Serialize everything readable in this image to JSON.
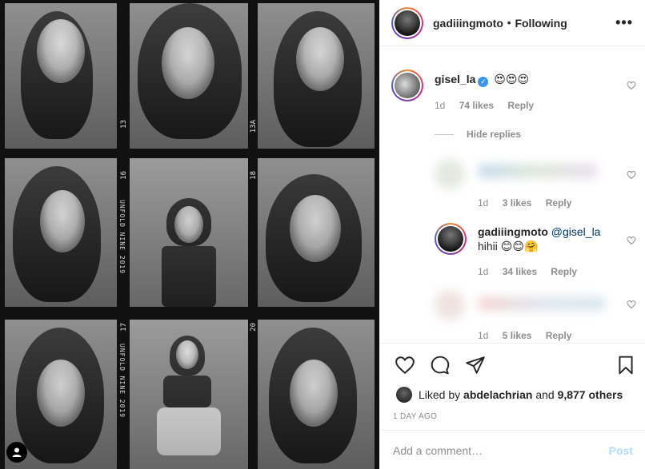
{
  "post": {
    "author": "gadiiingmoto",
    "follow_state": "Following",
    "separator": "•",
    "more_label": "•••"
  },
  "film_strip": {
    "edge_text": "UNFOLD NINE 2019",
    "frame_numbers": [
      "13",
      "13A",
      "16",
      "18",
      "17",
      "20"
    ]
  },
  "comments": {
    "main": {
      "username": "gisel_la",
      "verified": true,
      "text": "😍😍😍",
      "age": "1d",
      "likes": "74 likes",
      "reply_label": "Reply"
    },
    "hide_replies_label": "Hide replies",
    "replies": [
      {
        "username": "",
        "text": "",
        "age": "1d",
        "likes": "3 likes",
        "reply_label": "Reply",
        "blurred": true
      },
      {
        "username": "gadiiingmoto",
        "mention": "@gisel_la",
        "text": "hihii 😊😊🤗",
        "age": "1d",
        "likes": "34 likes",
        "reply_label": "Reply",
        "blurred": false
      },
      {
        "username": "",
        "text": "",
        "age": "1d",
        "likes": "5 likes",
        "reply_label": "Reply",
        "blurred": true
      }
    ]
  },
  "actions": {
    "liked_by_prefix": "Liked by",
    "liked_by_user": "abdelachrian",
    "liked_by_and": "and",
    "others_count": "9,877 others",
    "time_ago": "1 DAY AGO"
  },
  "composer": {
    "placeholder": "Add a comment…",
    "post_label": "Post"
  },
  "colors": {
    "verified": "#3897f0",
    "muted_text": "#8e8e8e",
    "post_button_disabled": "#b3dbff",
    "border": "#efefef"
  }
}
